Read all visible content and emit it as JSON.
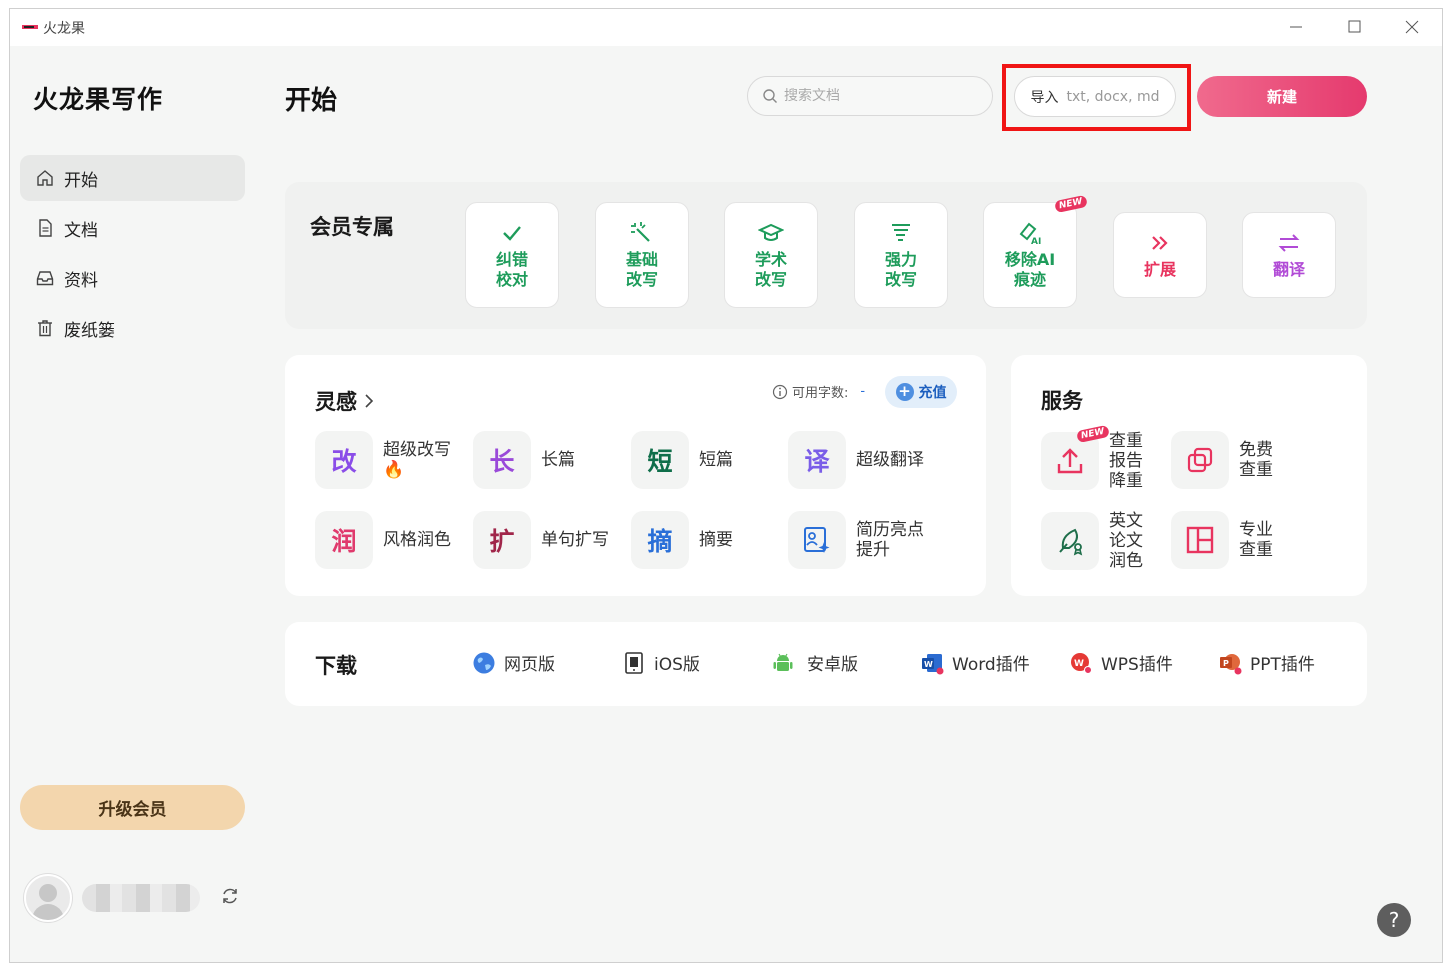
{
  "window": {
    "title": "火龙果"
  },
  "sidebar": {
    "brand": "火龙果写作",
    "items": [
      {
        "label": "开始",
        "icon": "home-icon",
        "active": true
      },
      {
        "label": "文档",
        "icon": "document-icon"
      },
      {
        "label": "资料",
        "icon": "inbox-icon"
      },
      {
        "label": "废纸篓",
        "icon": "trash-icon"
      }
    ],
    "upgrade_label": "升级会员"
  },
  "header": {
    "title": "开始",
    "search_placeholder": "搜索文档",
    "import_label": "导入",
    "import_formats": "txt, docx, md",
    "new_label": "新建"
  },
  "members": {
    "title": "会员专属",
    "features": [
      {
        "label1": "纠错",
        "label2": "校对",
        "color": "#1e9c5b",
        "icon": "check-icon"
      },
      {
        "label1": "基础",
        "label2": "改写",
        "color": "#1e9c5b",
        "icon": "magic-wand-icon"
      },
      {
        "label1": "学术",
        "label2": "改写",
        "color": "#1e9c5b",
        "icon": "graduation-cap-icon"
      },
      {
        "label1": "强力",
        "label2": "改写",
        "color": "#1e9c5b",
        "icon": "tornado-icon"
      },
      {
        "label1": "移除AI",
        "label2": "痕迹",
        "color": "#1e9c5b",
        "icon": "eraser-ai-icon",
        "badge": "NEW"
      },
      {
        "label1": "扩展",
        "label2": "",
        "color": "#e8345f",
        "icon": "double-chevron-icon"
      },
      {
        "label1": "翻译",
        "label2": "",
        "color": "#b14bd6",
        "icon": "swap-arrows-icon"
      }
    ]
  },
  "inspiration": {
    "title": "灵感",
    "credits_label": "可用字数:",
    "credits_value": "-",
    "recharge_label": "充值",
    "tools": [
      {
        "glyph": "改",
        "line1": "超级改写",
        "line2": "🔥",
        "color": "#8a4de8"
      },
      {
        "glyph": "长",
        "line1": "长篇",
        "line2": "",
        "color": "#9a4ad9"
      },
      {
        "glyph": "短",
        "line1": "短篇",
        "line2": "",
        "color": "#0f6e4a"
      },
      {
        "glyph": "译",
        "line1": "超级翻译",
        "line2": "",
        "color": "#7a5de8"
      },
      {
        "glyph": "润",
        "line1": "风格润色",
        "line2": "",
        "color": "#e03a6d"
      },
      {
        "glyph": "扩",
        "line1": "单句扩写",
        "line2": "",
        "color": "#a0264a"
      },
      {
        "glyph": "摘",
        "line1": "摘要",
        "line2": "",
        "color": "#2a6fd8"
      },
      {
        "glyph": "",
        "line1": "简历亮点",
        "line2": "提升",
        "color": "#2a6fd8",
        "icon": "resume-sparkle-icon"
      }
    ]
  },
  "services": {
    "title": "服务",
    "items": [
      {
        "lines": [
          "查重",
          "报告",
          "降重"
        ],
        "icon": "upload-icon",
        "color": "#e8345f",
        "badge": "NEW"
      },
      {
        "lines": [
          "免费",
          "查重"
        ],
        "icon": "copy-icon",
        "color": "#e8345f"
      },
      {
        "lines": [
          "英文",
          "论文",
          "润色"
        ],
        "icon": "quill-icon",
        "color": "#1e6e4a"
      },
      {
        "lines": [
          "专业",
          "查重"
        ],
        "icon": "layout-icon",
        "color": "#e8345f"
      }
    ]
  },
  "download": {
    "title": "下载",
    "items": [
      {
        "label": "网页版",
        "icon": "globe-icon"
      },
      {
        "label": "iOS版",
        "icon": "phone-icon"
      },
      {
        "label": "安卓版",
        "icon": "android-icon"
      },
      {
        "label": "Word插件",
        "icon": "word-icon"
      },
      {
        "label": "WPS插件",
        "icon": "wps-icon"
      },
      {
        "label": "PPT插件",
        "icon": "ppt-icon"
      }
    ]
  },
  "help_label": "?"
}
